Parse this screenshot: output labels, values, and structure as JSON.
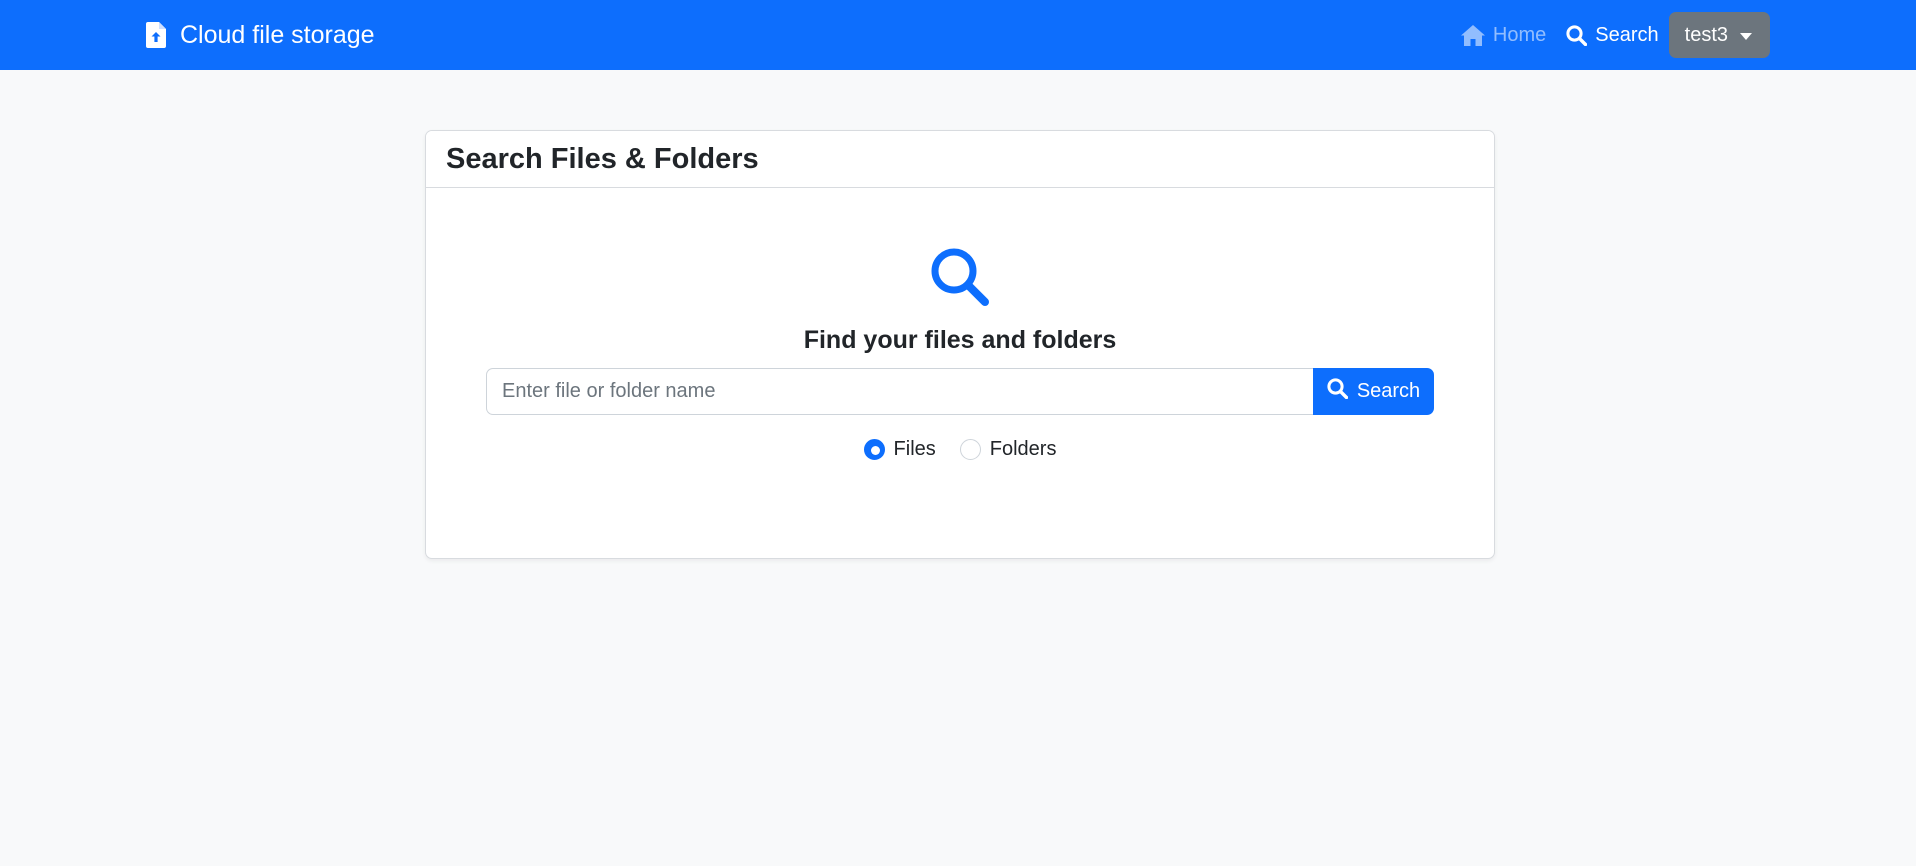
{
  "navbar": {
    "brand": "Cloud file storage",
    "home": "Home",
    "search": "Search",
    "user": "test3"
  },
  "card": {
    "title": "Search Files & Folders",
    "heading": "Find your files and folders",
    "search_placeholder": "Enter file or folder name",
    "search_button": "Search",
    "radio_files": "Files",
    "radio_folders": "Folders",
    "selected": "Files"
  },
  "colors": {
    "primary": "#0d6efd",
    "secondary": "#6c757d",
    "background": "#f8f9fa"
  },
  "icons": {
    "brand": "file-upload-icon",
    "home": "home-icon",
    "search": "search-icon"
  }
}
